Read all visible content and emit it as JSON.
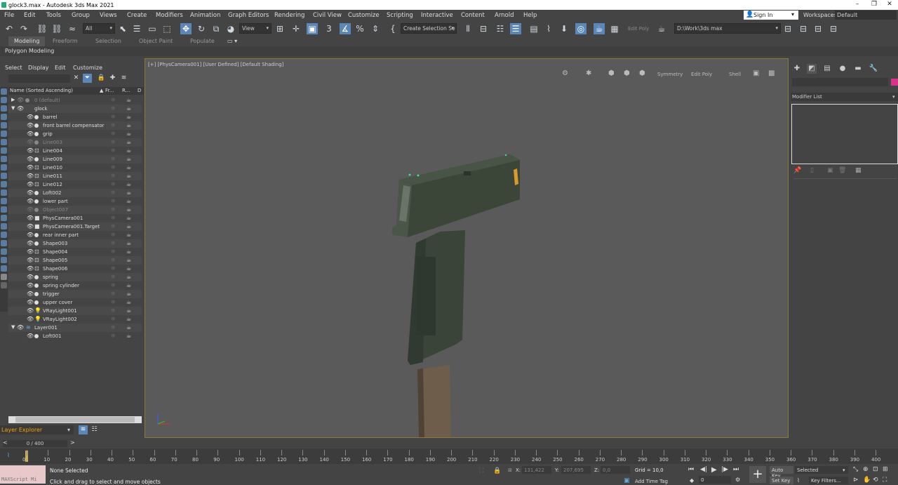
{
  "window": {
    "title": "glock3.max - Autodesk 3ds Max 2021"
  },
  "menu": [
    "File",
    "Edit",
    "Tools",
    "Group",
    "Views",
    "Create",
    "Modifiers",
    "Animation",
    "Graph Editors",
    "Rendering",
    "Civil View",
    "Customize",
    "Scripting",
    "Interactive",
    "Content",
    "Arnold",
    "Help"
  ],
  "account": {
    "sign_in": "Sign In",
    "workspaces_label": "Workspaces:",
    "workspace": "Default"
  },
  "toolbar": {
    "selection_filter": "All",
    "ref_coord": "View",
    "named_selection": "Create Selection Se",
    "edit_poly": "Edit Poly",
    "project_path": "D:\\Work\\3ds max"
  },
  "ribbon": {
    "tabs": [
      "Modeling",
      "Freeform",
      "Selection",
      "Object Paint",
      "Populate"
    ],
    "panel": "Polygon Modeling"
  },
  "explorer": {
    "menu": [
      "Select",
      "Display",
      "Edit",
      "Customize"
    ],
    "columns": {
      "name": "Name (Sorted Ascending)",
      "frozen": "Fr...",
      "render": "R...",
      "d": "D"
    },
    "rows": [
      {
        "name": "0 (default)",
        "dim": true
      },
      {
        "name": "glock"
      },
      {
        "name": "barrel"
      },
      {
        "name": "front barrel compensator"
      },
      {
        "name": "grip"
      },
      {
        "name": "Line003",
        "dim": true
      },
      {
        "name": "Line004"
      },
      {
        "name": "Line009"
      },
      {
        "name": "Line010"
      },
      {
        "name": "Line011"
      },
      {
        "name": "Line012"
      },
      {
        "name": "Loft002"
      },
      {
        "name": "lower part"
      },
      {
        "name": "Object007",
        "dim": true
      },
      {
        "name": "PhysCamera001"
      },
      {
        "name": "PhysCamera001.Target"
      },
      {
        "name": "rear inner part"
      },
      {
        "name": "Shape003"
      },
      {
        "name": "Shape004"
      },
      {
        "name": "Shape005"
      },
      {
        "name": "Shape006"
      },
      {
        "name": "spring"
      },
      {
        "name": "spring cylinder"
      },
      {
        "name": "trigger"
      },
      {
        "name": "upper cover"
      },
      {
        "name": "VRayLight001"
      },
      {
        "name": "VRayLight002"
      },
      {
        "name": "Layer001"
      },
      {
        "name": "Loft001"
      }
    ],
    "layer_explorer": "Layer Explorer"
  },
  "viewport": {
    "label": "[+] [PhysCamera001] [User Defined] [Default Shading]",
    "tools": [
      "Symmetry",
      "Edit Poly",
      "Shell"
    ]
  },
  "command_panel": {
    "modifier_list": "Modifier List",
    "object_color": "#d8338a"
  },
  "timeline": {
    "frame": "0 / 400",
    "ticks": [
      0,
      10,
      20,
      30,
      40,
      50,
      60,
      70,
      80,
      90,
      100,
      110,
      120,
      130,
      140,
      150,
      160,
      170,
      180,
      190,
      200,
      210,
      220,
      230,
      240,
      250,
      260,
      270,
      280,
      290,
      300,
      310,
      320,
      330,
      340,
      350,
      360,
      370,
      380,
      390,
      400
    ]
  },
  "status": {
    "maxscript": "MAXScript Mi",
    "selected": "None Selected",
    "prompt": "Click and drag to select and move objects",
    "x_label": "X:",
    "x": "131,422",
    "y_label": "Y:",
    "y": "207,695",
    "z_label": "Z:",
    "z": "0,0",
    "grid": "Grid = 10,0",
    "add_time_tag": "Add Time Tag",
    "frame_field": "0",
    "auto_key": "Auto Key",
    "set_key": "Set Key",
    "key_mode": "Selected",
    "key_filters": "Key Filters..."
  }
}
